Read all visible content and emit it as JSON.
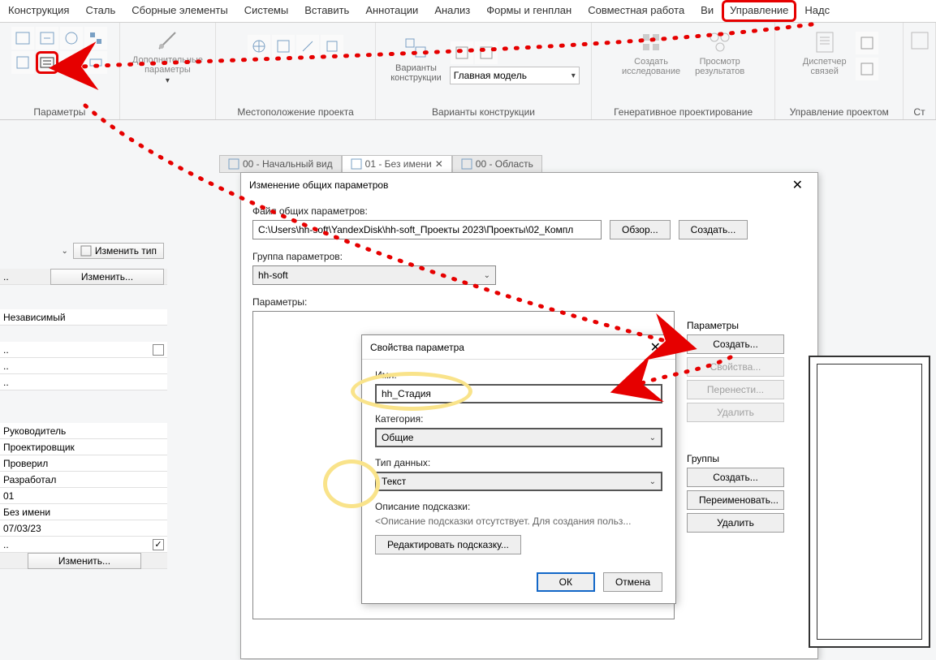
{
  "ribbon": {
    "tabs": [
      "Конструкция",
      "Сталь",
      "Сборные элементы",
      "Системы",
      "Вставить",
      "Аннотации",
      "Анализ",
      "Формы и генплан",
      "Совместная работа",
      "Ви",
      "Управление",
      "Надс"
    ],
    "highlighted_tab": "Управление",
    "panels": {
      "params": "Параметры",
      "params_add": "Дополнительные\nпараметры",
      "location": "Местоположение проекта",
      "variants": "Варианты конструкции",
      "variants_btn": "Варианты\nконструкции",
      "model_dd": "Главная модель",
      "gen_create": "Создать\nисследование",
      "gen_view": "Просмотр\nрезультатов",
      "gen": "Генеративное проектирование",
      "proj_disp": "Диспетчер\nсвязей",
      "proj": "Управление проектом",
      "st": "Ст"
    }
  },
  "view_tabs": {
    "t1": "00 - Начальный вид",
    "t2": "01 - Без имени",
    "t3": "00 - Область"
  },
  "left": {
    "edit_type": "Изменить тип",
    "edit": "Изменить...",
    "independent": "Независимый",
    "rows": {
      "r1": "Руководитель",
      "r2": "Проектировщик",
      "r3": "Проверил",
      "r4": "Разработал",
      "r5": "01",
      "r6": "Без имени",
      "r7": "07/03/23",
      "r8_btn": "Изменить..."
    }
  },
  "dlg1": {
    "title": "Изменение общих параметров",
    "file_lbl": "Файл общих параметров:",
    "file_val": "C:\\Users\\hh-soft\\YandexDisk\\hh-soft_Проекты 2023\\Проекты\\02_Компл",
    "browse": "Обзор...",
    "create": "Создать...",
    "group_lbl": "Группа параметров:",
    "group_val": "hh-soft",
    "params_lbl": "Параметры:",
    "side_params": "Параметры",
    "side_groups": "Группы",
    "btn_create": "Создать...",
    "btn_props": "Свойства...",
    "btn_move": "Перенести...",
    "btn_delete": "Удалить",
    "btn_rename": "Переименовать..."
  },
  "dlg2": {
    "title": "Свойства параметра",
    "name_lbl": "Имя:",
    "name_val": "hh_Стадия",
    "cat_lbl": "Категория:",
    "cat_val": "Общие",
    "type_lbl": "Тип данных:",
    "type_val": "Текст",
    "hint_lbl": "Описание подсказки:",
    "hint_val": "<Описание подсказки отсутствует. Для создания польз...",
    "edit_hint": "Редактировать подсказку...",
    "ok": "ОК",
    "cancel": "Отмена"
  }
}
